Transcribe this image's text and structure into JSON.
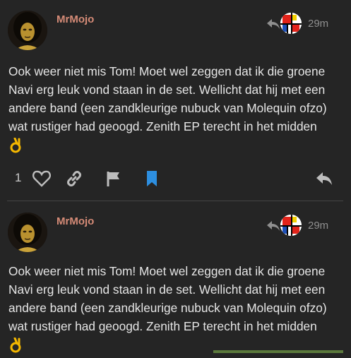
{
  "posts": [
    {
      "username": "MrMojo",
      "time": "29m",
      "body": "Ook weer niet mis Tom! Moet wel zeggen dat ik die groene Navi erg leuk vond staan in de set. Wellicht dat hij met een andere band (een zandkleurige nubuck van Molequin ofzo) wat rustiger had geoogd. Zenith EP terecht in het midden",
      "emoji": "ok-hand-emoji",
      "like_count": "1"
    },
    {
      "username": "MrMojo",
      "time": "29m",
      "body": "Ook weer niet mis Tom! Moet wel zeggen dat ik die groene Navi erg leuk vond staan in de set. Wellicht dat hij met een andere band (een zandkleurige nubuck van Molequin ofzo) wat rustiger had geoogd. Zenith EP terecht in het midden",
      "emoji": "ok-hand-emoji"
    }
  ],
  "colors": {
    "background": "#252525",
    "username": "#d58b77",
    "text": "#e6e6e6",
    "muted": "#8f8f8f",
    "bookmark_active": "#2d8fe0"
  }
}
